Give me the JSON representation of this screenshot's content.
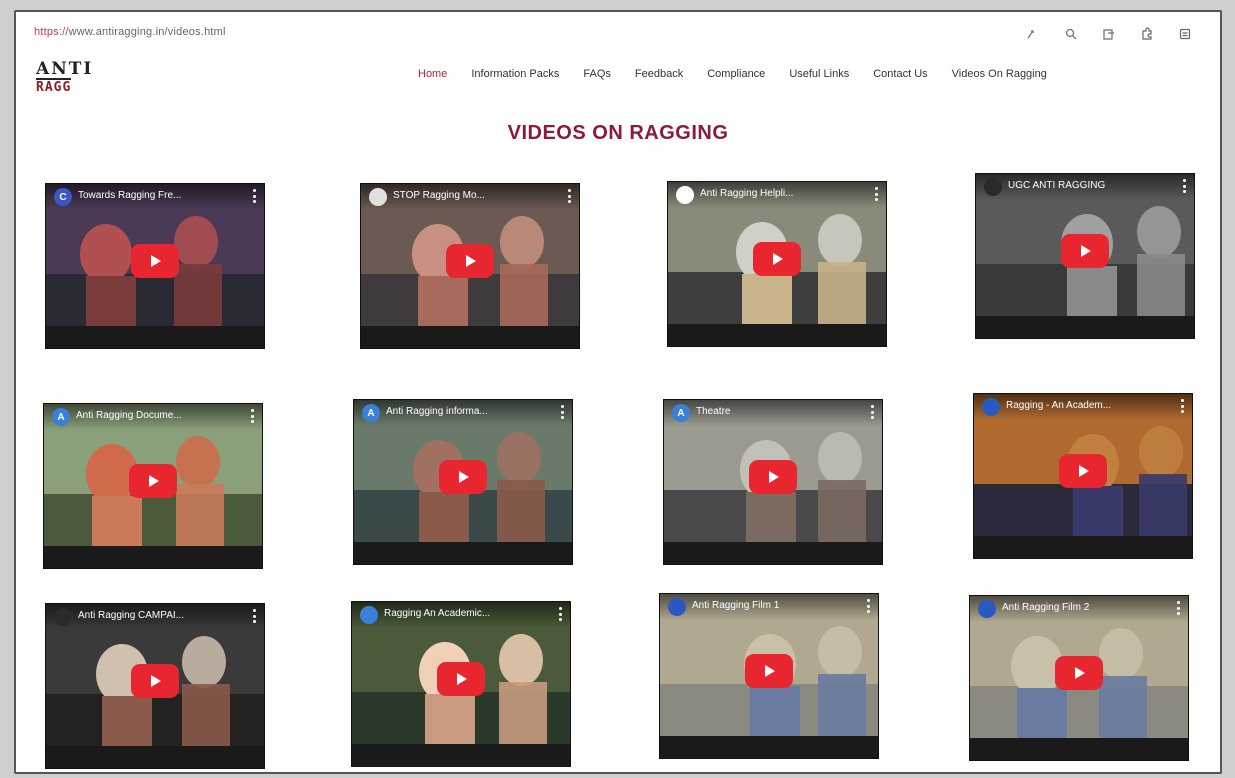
{
  "browser": {
    "url_prefix": "https://",
    "url_rest": "www.antiragging.in/videos.html",
    "icons": [
      "zoom-icon",
      "search-icon",
      "tab-icon",
      "extensions-icon",
      "menu-icon"
    ]
  },
  "header": {
    "logo_top": "ANTI",
    "logo_bottom": "RAGG",
    "nav": [
      {
        "label": "Home",
        "active": true
      },
      {
        "label": "Information Packs",
        "active": false
      },
      {
        "label": "FAQs",
        "active": false
      },
      {
        "label": "Feedback",
        "active": false
      },
      {
        "label": "Compliance",
        "active": false
      },
      {
        "label": "Useful Links",
        "active": false
      },
      {
        "label": "Contact Us",
        "active": false
      },
      {
        "label": "Videos On Ragging",
        "active": false
      }
    ]
  },
  "main": {
    "title": "VIDEOS ON RAGGING",
    "videos": [
      {
        "title": "Towards Ragging Fre...",
        "channel_letter": "C",
        "channel_color": "#3b57c4",
        "scene": [
          "#4b3a55",
          "#7a3b3b",
          "#2a2a35",
          "#b05050"
        ]
      },
      {
        "title": "STOP Ragging Mo...",
        "channel_letter": "",
        "channel_color": "#e0e0e0",
        "scene": [
          "#6a5a52",
          "#a86a5a",
          "#3e3a3e",
          "#c89080"
        ]
      },
      {
        "title": "Anti Ragging Helpli...",
        "channel_letter": "",
        "channel_color": "#ffffff",
        "scene": [
          "#8a8a7a",
          "#c8b38a",
          "#3e3e3e",
          "#d0d0c8"
        ]
      },
      {
        "title": "UGC ANTI RAGGING",
        "channel_letter": "",
        "channel_color": "#2a2a2a",
        "scene": [
          "#5a5a5a",
          "#8a8a8a",
          "#3a3a3a",
          "#a0a0a0"
        ]
      },
      {
        "title": "Anti Ragging Docume...",
        "channel_letter": "A",
        "channel_color": "#3a7fd8",
        "scene": [
          "#8aa07a",
          "#c87a5a",
          "#4a5a3a",
          "#d06a4a"
        ]
      },
      {
        "title": "Anti Ragging informa...",
        "channel_letter": "A",
        "channel_color": "#3a7fd8",
        "scene": [
          "#6a7a6a",
          "#8a5a4a",
          "#3a4a4a",
          "#a07060"
        ]
      },
      {
        "title": "Theatre",
        "channel_letter": "A",
        "channel_color": "#3a7fd8",
        "scene": [
          "#9a9a90",
          "#7a6a60",
          "#4a4a4a",
          "#c0c0b8"
        ]
      },
      {
        "title": "Ragging - An Academ...",
        "channel_letter": "",
        "channel_color": "#2a5ac0",
        "scene": [
          "#b06a30",
          "#3a3a6a",
          "#2a2a3a",
          "#c08040"
        ]
      },
      {
        "title": "Anti Ragging CAMPAI...",
        "channel_letter": "",
        "channel_color": "#2a2a2a",
        "scene": [
          "#3a3a3a",
          "#8a5a4a",
          "#222222",
          "#d0c0b0"
        ]
      },
      {
        "title": "Ragging An Academic...",
        "channel_letter": "",
        "channel_color": "#3a7fd8",
        "scene": [
          "#4a5a3a",
          "#c89a80",
          "#2a3a2a",
          "#f0d0b8"
        ]
      },
      {
        "title": "Anti Ragging Film 1",
        "channel_letter": "",
        "channel_color": "#2a5ac0",
        "scene": [
          "#b0a890",
          "#6a7aa0",
          "#8a8a80",
          "#c8c0a8"
        ]
      },
      {
        "title": "Anti Ragging Film 2",
        "channel_letter": "",
        "channel_color": "#2a5ac0",
        "scene": [
          "#b0a890",
          "#6a7aa0",
          "#8a8a80",
          "#c8c0a8"
        ]
      }
    ]
  }
}
